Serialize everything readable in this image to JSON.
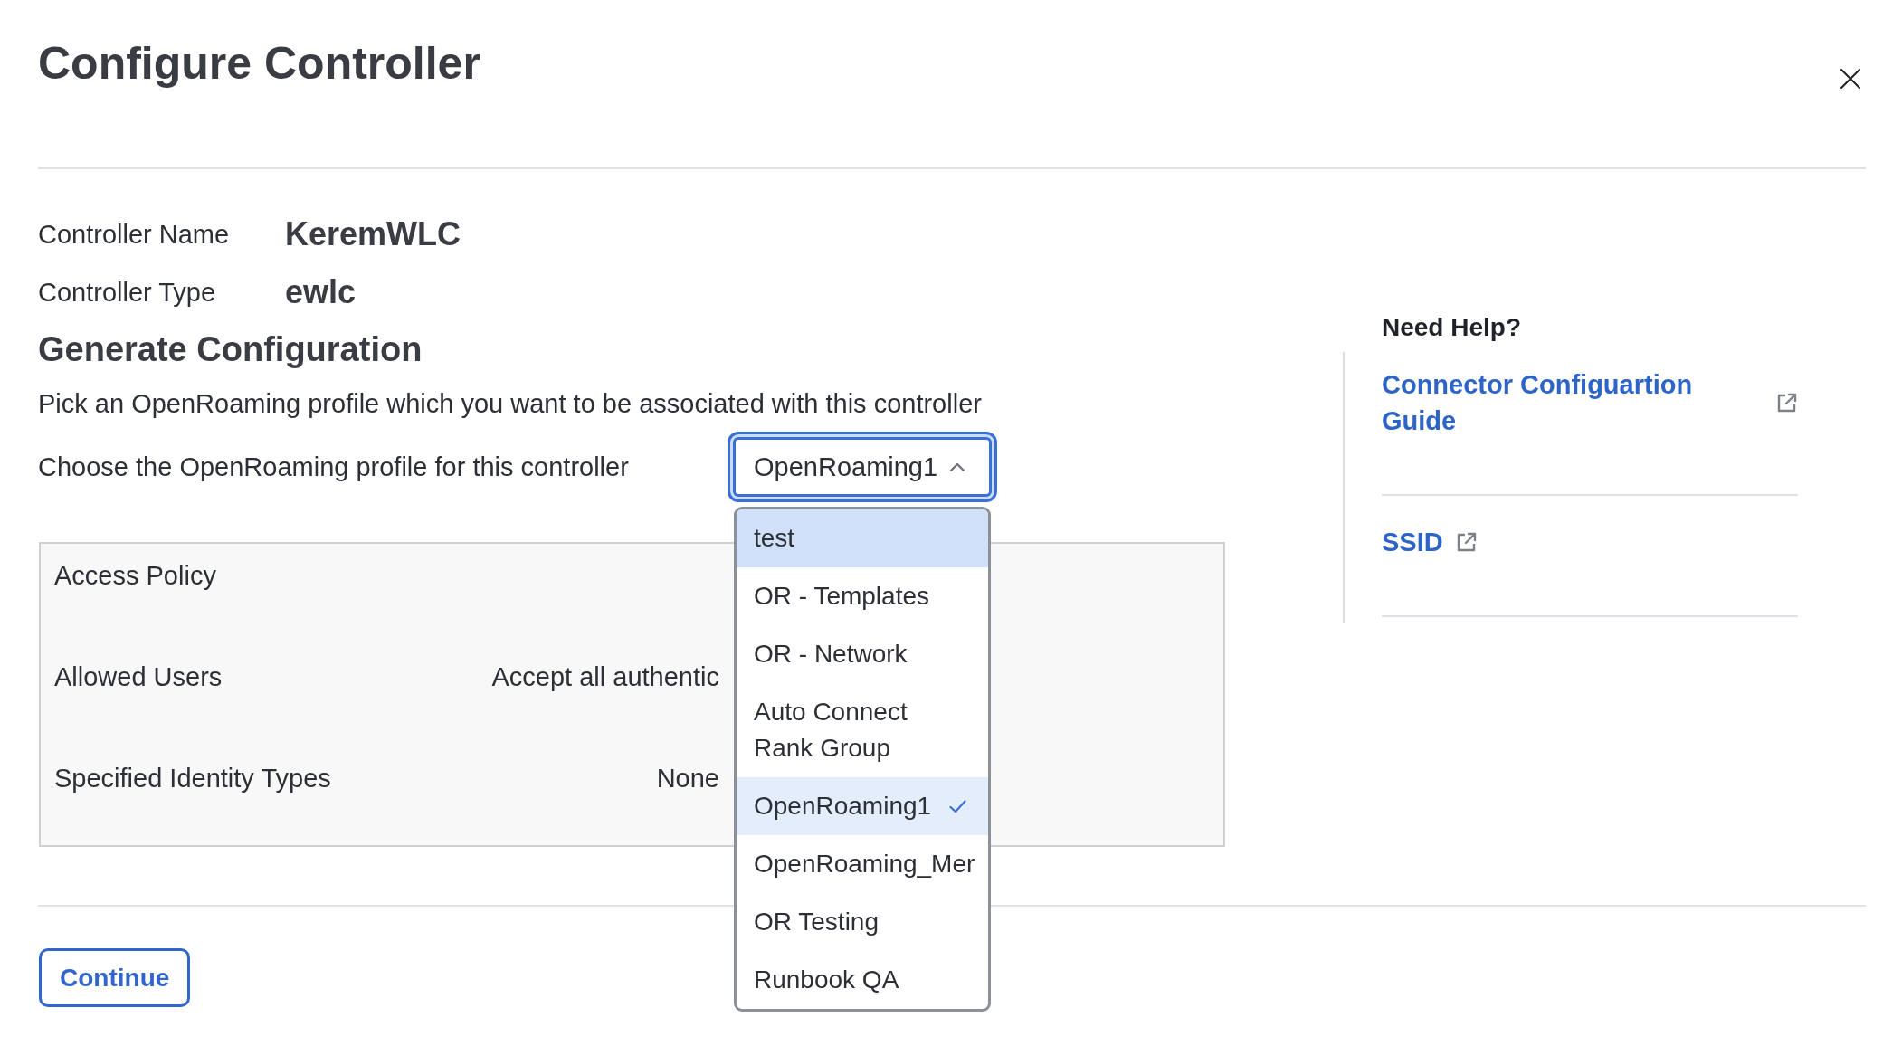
{
  "dialog": {
    "title": "Configure Controller"
  },
  "controller_details": [
    {
      "label": "Controller Name",
      "value": "KeremWLC"
    },
    {
      "label": "Controller Type",
      "value": "ewlc"
    }
  ],
  "generate_configuration": {
    "heading": "Generate Configuration",
    "description": "Pick an OpenRoaming profile which you want to be associated with this controller",
    "profile_label": "Choose the OpenRoaming profile for this controller",
    "profile_dropdown": {
      "value": "OpenRoaming1",
      "expanded": true,
      "options": [
        {
          "label": "test",
          "highlighted": true,
          "selected": false
        },
        {
          "label": "OR - Templates",
          "highlighted": false,
          "selected": false
        },
        {
          "label": "OR - Network",
          "highlighted": false,
          "selected": false
        },
        {
          "label": "Auto Connect Rank Group",
          "highlighted": false,
          "selected": false
        },
        {
          "label": "OpenRoaming1",
          "highlighted": false,
          "selected": true
        },
        {
          "label": "OpenRoaming_Mer",
          "highlighted": false,
          "selected": false
        },
        {
          "label": "OR Testing",
          "highlighted": false,
          "selected": false
        },
        {
          "label": "Runbook QA",
          "highlighted": false,
          "selected": false
        }
      ]
    }
  },
  "access_policy": {
    "title": "Access Policy",
    "rows": [
      {
        "label": "Allowed Users",
        "value": "Accept all authentic"
      },
      {
        "label": "Specified Identity Types",
        "value": "None"
      }
    ]
  },
  "help": {
    "title": "Need Help?",
    "links": [
      {
        "label": "Connector Configuartion Guide"
      },
      {
        "label": "SSID"
      }
    ]
  },
  "footer": {
    "buttons": [
      {
        "label": "Continue"
      }
    ]
  }
}
